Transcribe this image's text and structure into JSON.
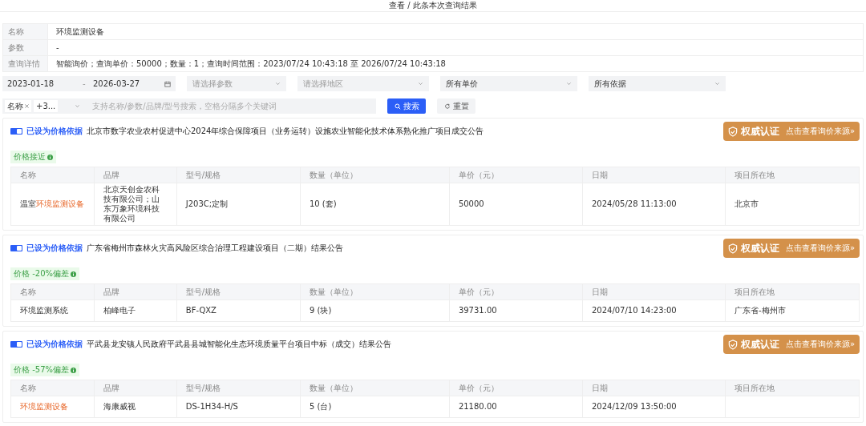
{
  "page_title": "查看 / 此条本次查询结果",
  "info": [
    {
      "label": "名称",
      "value": "环境监测设备"
    },
    {
      "label": "参数",
      "value": "-"
    },
    {
      "label": "查询详情",
      "value": "智能询价；查询单价：50000；数量：1；查询时间范围：2023/07/24 10:43:18 至 2026/07/24 10:43:18"
    }
  ],
  "filters": {
    "date_start": "2023-01-18",
    "date_separator": "-",
    "date_end": "2026-03-27",
    "selects": [
      {
        "placeholder": "请选择参数"
      },
      {
        "placeholder": "请选择地区"
      },
      {
        "value": "所有单价"
      },
      {
        "value": "所有依据"
      }
    ]
  },
  "search": {
    "tags": [
      {
        "label": "名称",
        "closable": true
      },
      {
        "label": "+3...",
        "closable": false
      }
    ],
    "placeholder": "支持名称/参数/品牌/型号搜索，空格分隔多个关键词",
    "search_button": "搜索",
    "reset_button": "重置"
  },
  "results": [
    {
      "basis_on": true,
      "basis_label": "已设为价格依据",
      "title": "北京市数字农业农村促进中心2024年综合保障项目（业务运转）设施农业智能化技术体系熟化推广项目成交公告",
      "badge": "权威认证",
      "source_link": "点击查看询价来源»",
      "tag": "价格接近",
      "columns": [
        "名称",
        "品牌",
        "型号/规格",
        "数量（单位）",
        "单价（元）",
        "日期",
        "项目所在地"
      ],
      "rows": [
        {
          "name": [
            {
              "text": "温室",
              "highlight": false
            },
            {
              "text": "环境监测设备",
              "highlight": true
            }
          ],
          "brand": "北京天创金农科技有限公司；山东万象环境科技有限公司",
          "model": "J203C;定制",
          "quantity": "10 (套)",
          "price": "50000",
          "date": "2024/05/28 11:13:00",
          "location": "北京市"
        }
      ]
    },
    {
      "basis_on": true,
      "basis_label": "已设为价格依据",
      "title": "广东省梅州市森林火灾高风险区综合治理工程建设项目（二期）结果公告",
      "badge": "权威认证",
      "source_link": "点击查看询价来源»",
      "tag": "价格 -20%偏差",
      "columns": [
        "名称",
        "品牌",
        "型号/规格",
        "数量（单位）",
        "单价（元）",
        "日期",
        "项目所在地"
      ],
      "rows": [
        {
          "name": [
            {
              "text": "环境监测系统",
              "highlight": false
            }
          ],
          "brand": "柏峰电子",
          "model": "BF-QXZ",
          "quantity": "9 (块)",
          "price": "39731.00",
          "date": "2024/07/10 14:23:00",
          "location": "广东省-梅州市"
        }
      ]
    },
    {
      "basis_on": true,
      "basis_label": "已设为价格依据",
      "title": "平武县龙安镇人民政府平武县县城智能化生态环境质量平台项目中标（成交）结果公告",
      "badge": "权威认证",
      "source_link": "点击查看询价来源»",
      "tag": "价格 -57%偏差",
      "columns": [
        "名称",
        "品牌",
        "型号/规格",
        "数量（单位）",
        "单价（元）",
        "日期",
        "项目所在地"
      ],
      "rows": [
        {
          "name": [
            {
              "text": "环境监测设备",
              "highlight": true
            }
          ],
          "brand": "海康威视",
          "model": "DS-1H34-H/S",
          "quantity": "5 (台)",
          "price": "21180.00",
          "date": "2024/12/09 13:50:00"
        }
      ]
    }
  ]
}
